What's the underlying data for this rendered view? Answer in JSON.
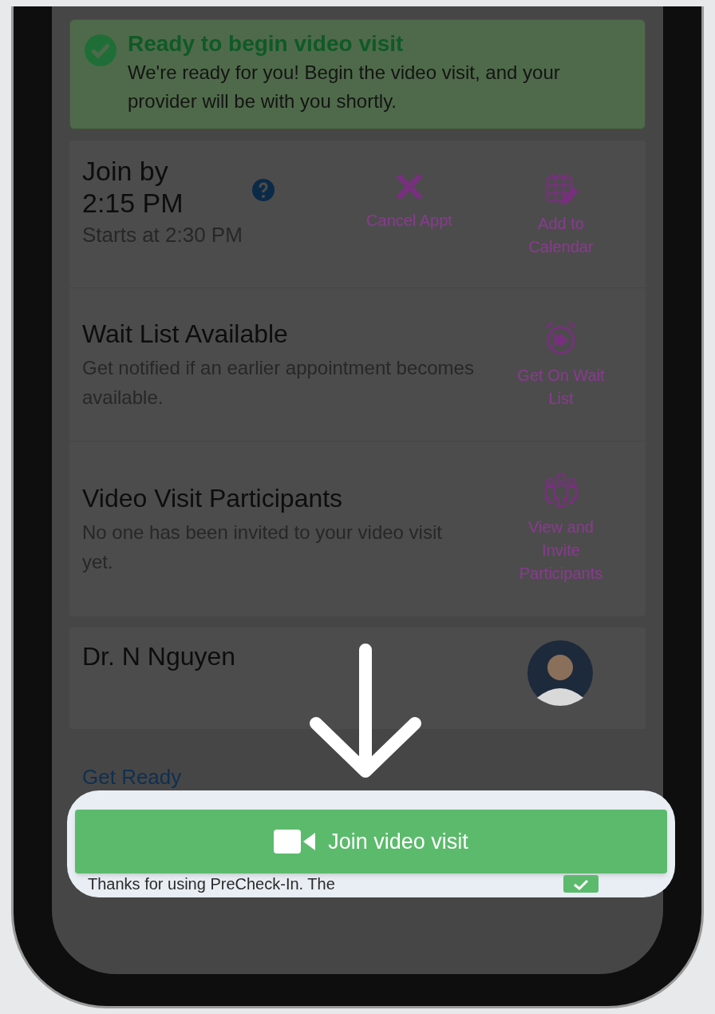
{
  "banner": {
    "title": "Ready to begin video visit",
    "message": "We're ready for you! Begin the video visit, and your provider will be with you shortly."
  },
  "appointment": {
    "join_by": "Join by 2:15 PM",
    "starts": "Starts at 2:30 PM",
    "actions": [
      {
        "kind": "cancel",
        "label": "Cancel Appt"
      },
      {
        "kind": "calendar",
        "label": "Add to Calendar"
      }
    ]
  },
  "sections": [
    {
      "title": "Wait List Available",
      "description": "Get notified if an earlier appointment becomes available.",
      "action": {
        "kind": "waitlist",
        "label": "Get On Wait List"
      }
    },
    {
      "title": "Video Visit Participants",
      "description": "No one has been invited to your video visit yet.",
      "action": {
        "kind": "participants",
        "label": "View and Invite Participants"
      }
    }
  ],
  "provider": {
    "name": "Dr. N Nguyen"
  },
  "get_ready": "Get Ready",
  "join_button": "Join video visit",
  "precheck_text": "Thanks for using PreCheck-In. The"
}
